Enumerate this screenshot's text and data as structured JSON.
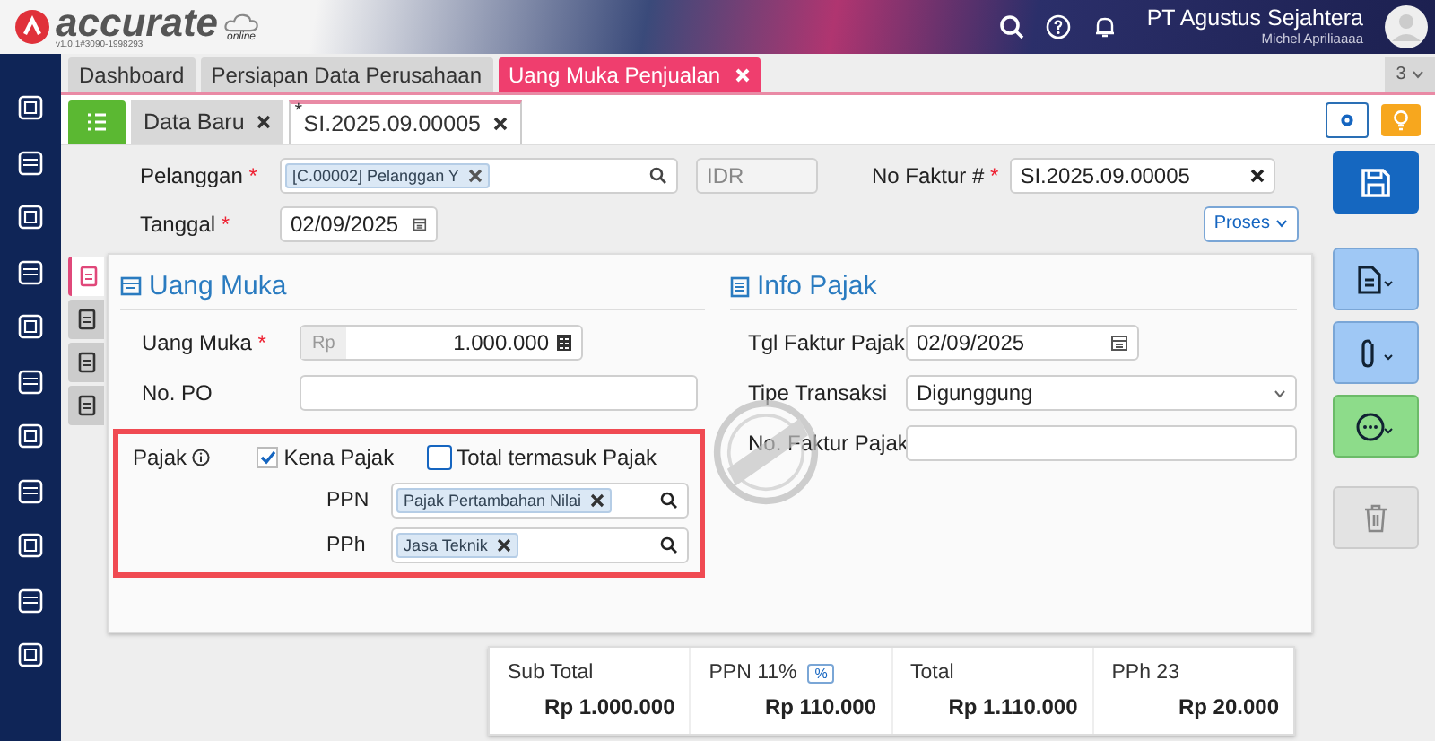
{
  "header": {
    "logo": "accurate",
    "logo_sub": "online",
    "version": "v1.0.1#3090-1998293",
    "company": "PT Agustus Sejahtera",
    "user": "Michel Apriliaaaa"
  },
  "main_tabs": [
    {
      "label": "Dashboard",
      "selected": false,
      "closable": false
    },
    {
      "label": "Persiapan Data Perusahaan",
      "selected": false,
      "closable": false
    },
    {
      "label": "Uang Muka Penjualan",
      "selected": true,
      "closable": true
    }
  ],
  "tab_count": "3",
  "doc_tabs": [
    {
      "label": "Data Baru",
      "selected": false
    },
    {
      "label": "SI.2025.09.00005",
      "selected": true,
      "marker": "*"
    }
  ],
  "required_mark": "*",
  "header_form": {
    "customer_label": "Pelanggan",
    "customer_tag": "[C.00002] Pelanggan Y",
    "currency": "IDR",
    "invoice_label": "No Faktur #",
    "invoice_no": "SI.2025.09.00005",
    "date_label": "Tanggal",
    "date": "02/09/2025",
    "process_button": "Proses"
  },
  "side_tabs": [
    {
      "selected": true
    },
    {
      "selected": false
    },
    {
      "selected": false
    },
    {
      "selected": false
    }
  ],
  "down_payment": {
    "title": "Uang Muka",
    "amount_label": "Uang Muka",
    "currency_prefix": "Rp",
    "amount": "1.000.000",
    "po_label": "No. PO",
    "tax_label": "Pajak",
    "taxable": {
      "label": "Kena Pajak",
      "checked": true
    },
    "tax_inclusive": {
      "label": "Total termasuk Pajak",
      "checked": false
    },
    "ppn_label": "PPN",
    "ppn_tag": "Pajak Pertambahan Nilai",
    "pph_label": "PPh",
    "pph_tag": "Jasa Teknik"
  },
  "tax_info": {
    "title": "Info Pajak",
    "date_label": "Tgl Faktur Pajak",
    "date": "02/09/2025",
    "type_label": "Tipe Transaksi",
    "type": "Digunggung",
    "no_label": "No. Faktur Pajak"
  },
  "totals": [
    {
      "label": "Sub Total",
      "value": "Rp 1.000.000"
    },
    {
      "label": "PPN 11%",
      "value": "Rp 110.000",
      "badge": "%"
    },
    {
      "label": "Total",
      "value": "Rp 1.110.000"
    },
    {
      "label": "PPh 23",
      "value": "Rp 20.000"
    }
  ]
}
